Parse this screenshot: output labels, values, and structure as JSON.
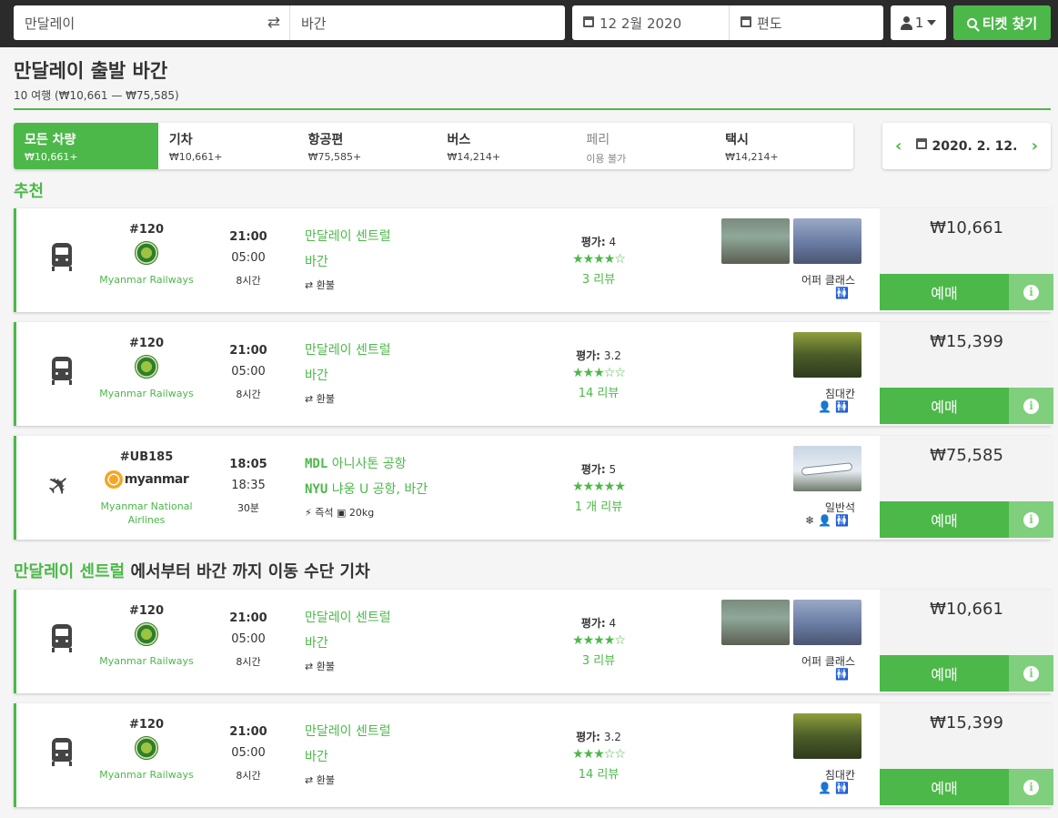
{
  "search": {
    "from": "만달레이",
    "to": "바간",
    "date": "12 2월 2020",
    "return": "편도",
    "passengers": "1",
    "find_label": "티켓 찾기"
  },
  "header": {
    "title": "만달레이 출발 바간",
    "subtitle": "10 여행 (₩10,661 — ₩75,585)"
  },
  "tabs": [
    {
      "label": "모든 차량",
      "price": "₩10,661+"
    },
    {
      "label": "기차",
      "price": "₩10,661+"
    },
    {
      "label": "항공편",
      "price": "₩75,585+"
    },
    {
      "label": "버스",
      "price": "₩14,214+"
    },
    {
      "label": "페리",
      "price": "이용 불가"
    },
    {
      "label": "택시",
      "price": "₩14,214+"
    }
  ],
  "date_nav": {
    "date": "2020. 2. 12."
  },
  "section1": {
    "title": "추천"
  },
  "section2": {
    "station": "만달레이 센트럴",
    "rest": "에서부터 바간 까지 이동 수단 기차"
  },
  "results": [
    {
      "mode": "train",
      "number": "#120",
      "operator": "Myanmar Railways",
      "dep": "21:00",
      "arr": "05:00",
      "dur": "8시간",
      "from": "만달레이 센트럴",
      "to": "바간",
      "extra": "⇄ 환불",
      "rating_label": "평가:",
      "rating": "4",
      "stars": "★★★★☆",
      "reviews": "3 리뷰",
      "class": "어퍼 클래스",
      "amenities": "🚻",
      "price": "₩10,661",
      "book": "예매"
    },
    {
      "mode": "train",
      "number": "#120",
      "operator": "Myanmar Railways",
      "dep": "21:00",
      "arr": "05:00",
      "dur": "8시간",
      "from": "만달레이 센트럴",
      "to": "바간",
      "extra": "⇄ 환불",
      "rating_label": "평가:",
      "rating": "3.2",
      "stars": "★★★☆☆",
      "reviews": "14 리뷰",
      "class": "침대칸",
      "amenities": "👤🚻",
      "price": "₩15,399",
      "book": "예매"
    },
    {
      "mode": "plane",
      "number": "#UB185",
      "operator": "Myanmar National Airlines",
      "logo_text": "myanmar",
      "dep": "18:05",
      "arr": "18:35",
      "dur": "30분",
      "from_code": "MDL",
      "from": "아니사톤 공항",
      "to_code": "NYU",
      "to": "냐웅 U 공항, 바간",
      "extra": "⚡ 즉석   ▣ 20kg",
      "rating_label": "평가:",
      "rating": "5",
      "stars": "★★★★★",
      "reviews": "1 개 리뷰",
      "class": "일반석",
      "amenities": "❄👤🚻",
      "price": "₩75,585",
      "book": "예매"
    },
    {
      "mode": "train",
      "number": "#120",
      "operator": "Myanmar Railways",
      "dep": "21:00",
      "arr": "05:00",
      "dur": "8시간",
      "from": "만달레이 센트럴",
      "to": "바간",
      "extra": "⇄ 환불",
      "rating_label": "평가:",
      "rating": "4",
      "stars": "★★★★☆",
      "reviews": "3 리뷰",
      "class": "어퍼 클래스",
      "amenities": "🚻",
      "price": "₩10,661",
      "book": "예매"
    },
    {
      "mode": "train",
      "number": "#120",
      "operator": "Myanmar Railways",
      "dep": "21:00",
      "arr": "05:00",
      "dur": "8시간",
      "from": "만달레이 센트럴",
      "to": "바간",
      "extra": "⇄ 환불",
      "rating_label": "평가:",
      "rating": "3.2",
      "stars": "★★★☆☆",
      "reviews": "14 리뷰",
      "class": "침대칸",
      "amenities": "👤🚻",
      "price": "₩15,399",
      "book": "예매"
    }
  ]
}
